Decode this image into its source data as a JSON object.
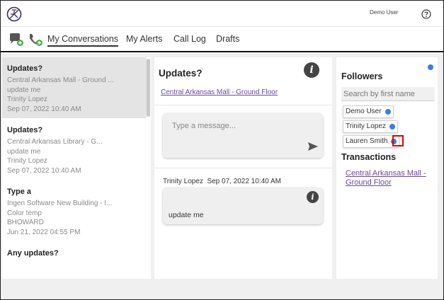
{
  "header": {
    "user_name": "Demo User"
  },
  "nav": {
    "tabs": [
      {
        "label": "My Conversations",
        "active": true
      },
      {
        "label": "My Alerts",
        "active": false
      },
      {
        "label": "Call Log",
        "active": false
      },
      {
        "label": "Drafts",
        "active": false
      }
    ]
  },
  "conversations": [
    {
      "title": "Updates?",
      "location": "Central Arkansas Mall - Ground ...",
      "message": "update me",
      "author": "Trinity Lopez",
      "timestamp": "Sep 07, 2022 10:40 AM",
      "selected": true
    },
    {
      "title": "Updates?",
      "location": "Central Arkansas  Library - G...",
      "message": "update me",
      "author": "Trinity Lopez",
      "timestamp": "Sep 07, 2022 10:40 AM",
      "selected": false
    },
    {
      "title": "Type a",
      "location": "Ingen Software New Building - I...",
      "message": "Color temp",
      "author": "BHOWARD",
      "timestamp": "Jun 21, 2022 04:55 PM",
      "selected": false
    },
    {
      "title": "Any updates?"
    }
  ],
  "detail": {
    "title": "Updates?",
    "link": "Central Arkansas Mall - Ground Floor",
    "compose_placeholder": "Type a message...",
    "message": {
      "author": "Trinity Lopez",
      "timestamp": "Sep 07, 2022 10:40 AM",
      "text": "update me"
    }
  },
  "followers": {
    "heading": "Followers",
    "search_placeholder": "Search by first name",
    "chips": [
      "Demo User",
      "Trinity Lopez",
      "Lauren Smith"
    ]
  },
  "transactions": {
    "heading": "Transactions",
    "items": [
      "Central Arkansas Mall - Ground Floor"
    ]
  },
  "colors": {
    "accent_blue": "#3b7de3",
    "link_purple": "#6a4a9a",
    "highlight_red": "#e00000",
    "icon_green": "#4caf50"
  }
}
